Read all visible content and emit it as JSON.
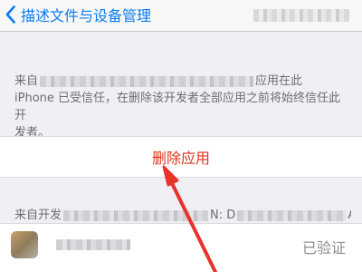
{
  "navbar": {
    "back_label": "描述文件与设备管理"
  },
  "info": {
    "line1_prefix": "来自",
    "line1_suffix": "应用在此",
    "line2": "iPhone 已受信任，在删除该开发者全部应用之前将始终信任此开",
    "line3": "发者。"
  },
  "action": {
    "delete_label": "删除应用"
  },
  "developer": {
    "prefix": "来自开发",
    "mid": "N: D",
    "suffix": "A"
  },
  "app": {
    "status": "已验证"
  },
  "colors": {
    "accent": "#0a7cf0",
    "destructive": "#e0321f",
    "annotation_arrow": "#e8322a"
  }
}
